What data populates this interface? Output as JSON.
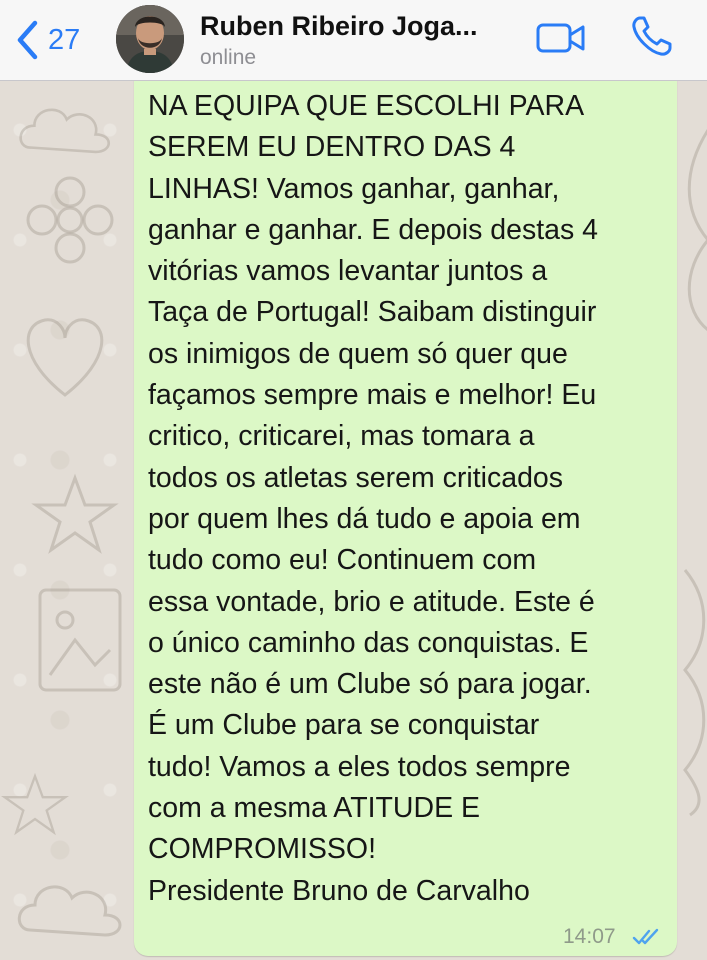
{
  "header": {
    "back_count": "27",
    "contact_name": "Ruben Ribeiro Joga...",
    "status": "online"
  },
  "message": {
    "text": "NA EQUIPA QUE ESCOLHI PARA\nSEREM EU DENTRO DAS 4\nLINHAS! Vamos ganhar, ganhar,\nganhar e ganhar. E depois destas 4\nvitórias vamos levantar juntos a\nTaça de Portugal! Saibam distinguir\nos inimigos de quem só quer que\nfaçamos sempre mais e melhor! Eu\ncritico, criticarei, mas tomara a\ntodos os atletas serem criticados\npor quem lhes dá tudo e apoia em\ntudo como eu! Continuem com\nessa vontade, brio e atitude. Este é\no único caminho das conquistas. E\neste não é um Clube só para jogar.\nÉ um Clube para se conquistar\ntudo! Vamos a eles todos sempre\ncom a mesma ATITUDE E\nCOMPROMISSO!\nPresidente Bruno de Carvalho",
    "time": "14:07",
    "status_icon": "double-check-read-icon"
  },
  "colors": {
    "accent": "#2a7cf6",
    "bubble": "#dcf8c6",
    "header_bg": "#f7f7f7"
  },
  "icons": {
    "back": "chevron-left-icon",
    "video": "video-camera-icon",
    "phone": "phone-icon"
  }
}
